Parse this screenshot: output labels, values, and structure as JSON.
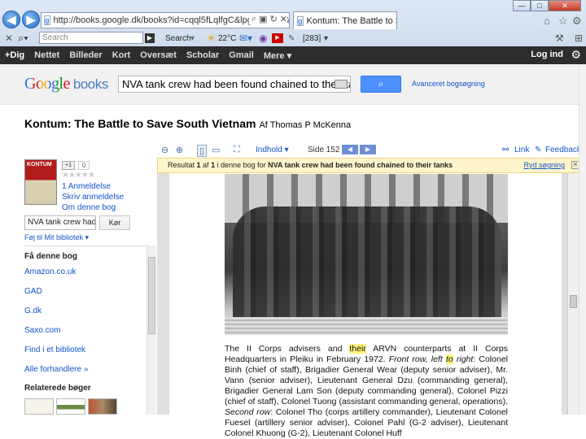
{
  "browser": {
    "url": "http://books.google.dk/books?id=cqql5fLqlfgC&lpg=PA184&",
    "tab_title": "Kontum: The Battle to Save...",
    "toolbar_search_placeholder": "Search",
    "search_btn": "Search",
    "weather": "22°C",
    "counter": "[283]"
  },
  "gbar": {
    "items": [
      "+Dig",
      "Nettet",
      "Billeder",
      "Kort",
      "Oversæt",
      "Scholar",
      "Gmail",
      "Mere ▾"
    ],
    "login": "Log ind"
  },
  "header": {
    "logo_google": "Google",
    "logo_books": "books",
    "query": "NVA tank crew had been found chained to their tank",
    "advanced": "Avanceret bogsøgning"
  },
  "book": {
    "title": "Kontum: The Battle to Save South Vietnam",
    "author": "Af Thomas P McKenna",
    "cover_text": "KONTUM"
  },
  "sidebar": {
    "plus_one": "+1",
    "count": "0",
    "links": [
      "1 Anmeldelse",
      "Skriv anmeldelse",
      "Om denne bog"
    ],
    "search_value": "NVA tank crew had b",
    "search_btn": "Kør",
    "add_library": "Føj til Mit bibliotek ▾",
    "buy_heading": "Få denne bog",
    "stores": [
      "Amazon.co.uk",
      "GAD",
      "G.dk",
      "Saxo.com",
      "Find i et bibliotek",
      "Alle forhandlere »"
    ],
    "related_heading": "Relaterede bøger"
  },
  "viewer": {
    "contents": "Indhold ▾",
    "page_label": "Side 152",
    "link": "Link",
    "feedback": "Feedback",
    "result_prefix": "Resultat ",
    "result_bold1": "1",
    "result_mid": " af ",
    "result_bold2": "1",
    "result_suffix": " i denne bog for ",
    "result_query": "NVA tank crew had been found chained to their tanks",
    "clear": "Ryd søgning"
  },
  "caption": {
    "p1": "The II Corps advisers and ",
    "highlight": "their",
    "p2": " ARVN counterparts at II Corps Headquarters in Pleiku in February 1972. ",
    "italic1": "Front row, left ",
    "highlight2": "to",
    "italic2": " right",
    "p3": ": Colonel Binh (chief of staff), Brigadier General Wear (deputy senior adviser), Mr. Vann (senior adviser), Lieutenant General Dzu (commanding general), Brigadier General Lam Son (deputy commanding general), Colonel Pizzi (chief of staff), Colonel Tuong (assistant commanding general, operations). ",
    "italic3": "Second row",
    "p4": ": Colonel Tho (corps artillery commander), Lieutenant Colonel Fuesel (artillery senior adviser), Colonel Pahl (G-2 adviser), Lieutenant Colonel Khuong (G-2), Lieutenant Colonel Huff"
  }
}
